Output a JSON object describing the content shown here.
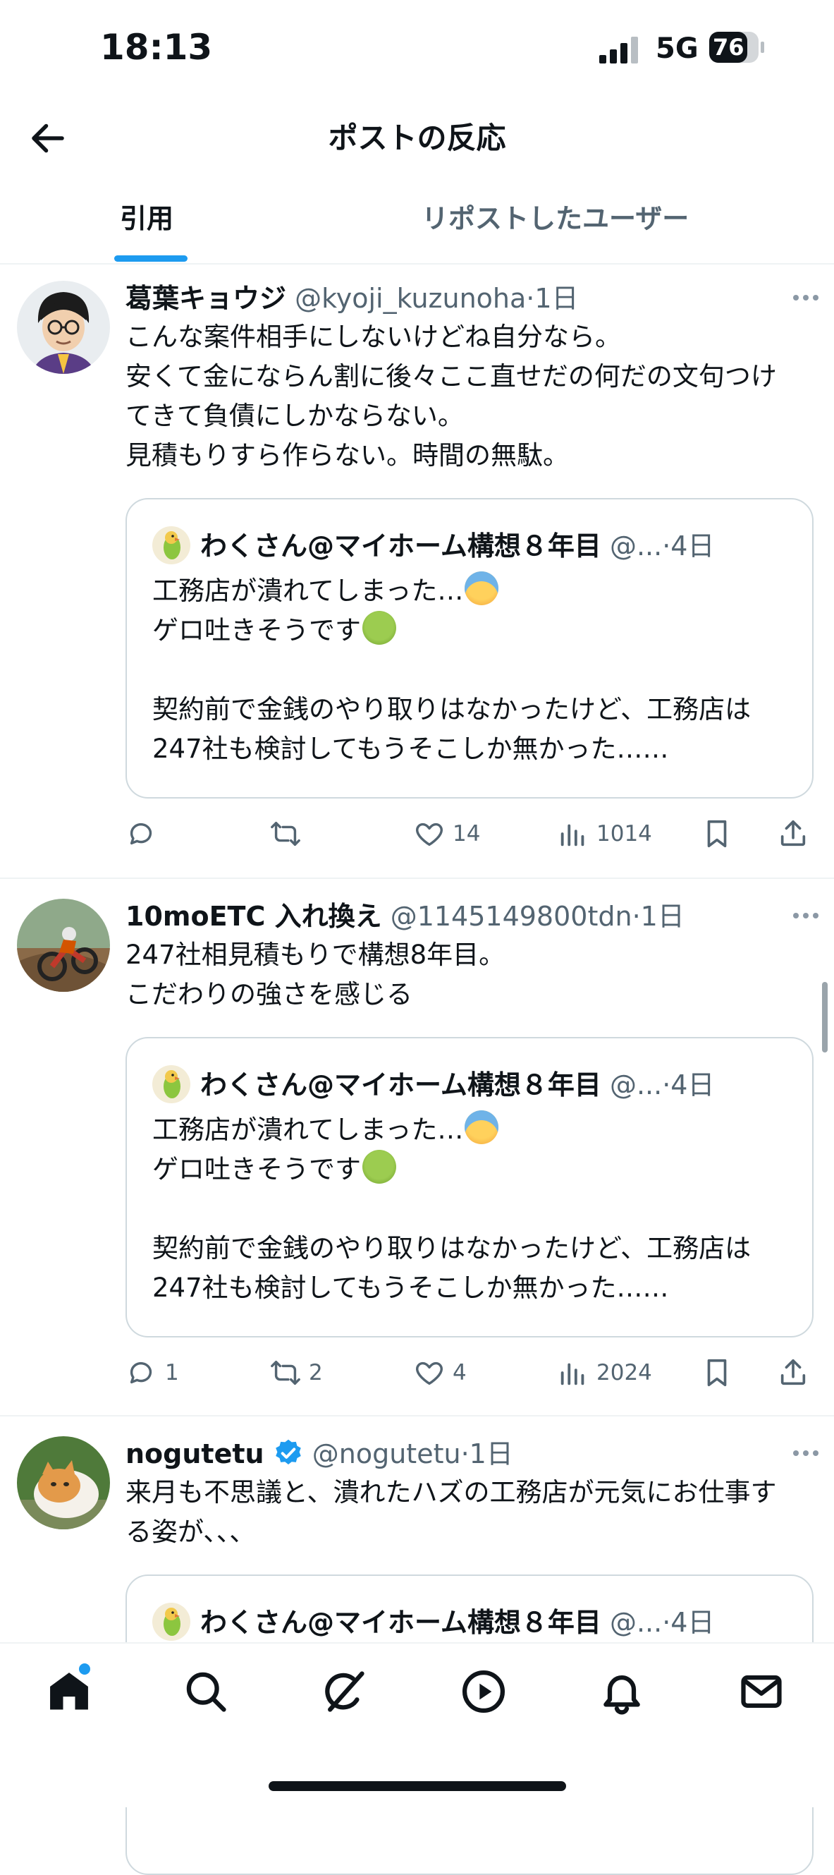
{
  "status_bar": {
    "time": "18:13",
    "network": "5G",
    "battery": "76"
  },
  "header": {
    "title": "ポストの反応"
  },
  "tabs": [
    {
      "label": "引用",
      "active": true
    },
    {
      "label": "リポストしたユーザー",
      "active": false
    }
  ],
  "posts": [
    {
      "name": "葛葉キョウジ",
      "handle": "@kyoji_kuzunoha",
      "time": "·1日",
      "verified": false,
      "text": "こんな案件相手にしないけどね自分なら。\n安くて金にならん割に後々ここ直せだの何だの文句つけてきて負債にしかならない。\n見積もりすら作らない。時間の無駄。",
      "quote": {
        "name": "わくさん@マイホーム構想８年目",
        "handle": "@...",
        "time": "·4日",
        "line1": "工務店が潰れてしまった…",
        "line2": "ゲロ吐きそうです",
        "line3": "契約前で金銭のやり取りはなかったけど、工務店は247社も検討してもうそこしか無かった……"
      },
      "stats": {
        "replies": "",
        "reposts": "",
        "likes": "14",
        "views": "1014"
      }
    },
    {
      "name": "10moETC 入れ換え",
      "handle": "@1145149800tdn",
      "time": "·1日",
      "verified": false,
      "text": "247社相見積もりで構想8年目。\nこだわりの強さを感じる",
      "quote": {
        "name": "わくさん@マイホーム構想８年目",
        "handle": "@...",
        "time": "·4日",
        "line1": "工務店が潰れてしまった…",
        "line2": "ゲロ吐きそうです",
        "line3": "契約前で金銭のやり取りはなかったけど、工務店は247社も検討してもうそこしか無かった……"
      },
      "stats": {
        "replies": "1",
        "reposts": "2",
        "likes": "4",
        "views": "2024"
      }
    },
    {
      "name": "nogutetu",
      "handle": "@nogutetu",
      "time": "·1日",
      "verified": true,
      "text": "来月も不思議と、潰れたハズの工務店が元気にお仕事する姿が、、、",
      "quote": {
        "name": "わくさん@マイホーム構想８年目",
        "handle": "@...",
        "time": "·4日"
      }
    }
  ],
  "bottom_nav": [
    {
      "icon": "home-icon",
      "active": true,
      "notification_dot": true
    },
    {
      "icon": "search-icon"
    },
    {
      "icon": "grok-icon"
    },
    {
      "icon": "video-icon"
    },
    {
      "icon": "notifications-icon"
    },
    {
      "icon": "messages-icon"
    }
  ],
  "colors": {
    "accent": "#1d9bf0",
    "text": "#0f1419",
    "secondary": "#536471",
    "border": "#cfd9de"
  }
}
